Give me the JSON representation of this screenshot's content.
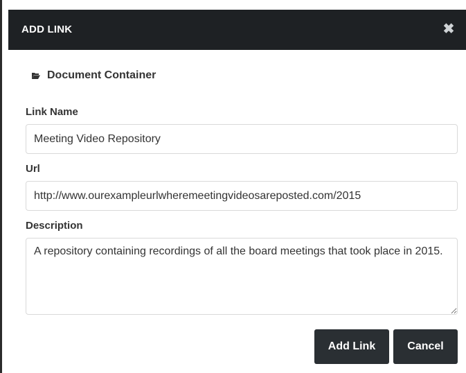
{
  "dialog": {
    "title": "ADD LINK",
    "close_symbol": "✖",
    "container": {
      "icon": "folder-open-icon",
      "label": "Document Container"
    },
    "fields": {
      "link_name": {
        "label": "Link Name",
        "value": "Meeting Video Repository"
      },
      "url": {
        "label": "Url",
        "value": "http://www.ourexampleurlwheremeetingvideosareposted.com/2015"
      },
      "description": {
        "label": "Description",
        "value": "A repository containing recordings of all the board meetings that took place in 2015."
      }
    },
    "buttons": {
      "add_label": "Add Link",
      "cancel_label": "Cancel"
    }
  },
  "colors": {
    "header_bg": "#1e2124",
    "button_bg": "#2a2f33",
    "input_border": "#d9d9d9"
  }
}
